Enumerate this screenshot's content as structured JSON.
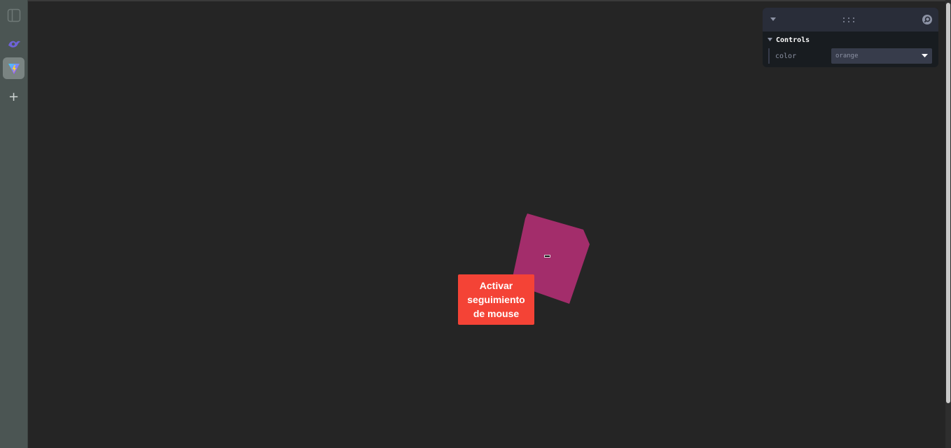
{
  "sidebar": {
    "items": [
      {
        "icon": "panel-toggle-icon"
      },
      {
        "icon": "bird-logo-icon"
      },
      {
        "icon": "vite-logo-icon",
        "active": true
      },
      {
        "icon": "plus-icon",
        "glyph": "+"
      }
    ]
  },
  "scene": {
    "cube_color": "#a32d6b",
    "button_label": "Activar\nseguimiento\nde mouse",
    "button_color": "#f44336"
  },
  "controls_panel": {
    "folder_title": "Controls",
    "fields": [
      {
        "label": "color",
        "value": "orange"
      }
    ]
  }
}
